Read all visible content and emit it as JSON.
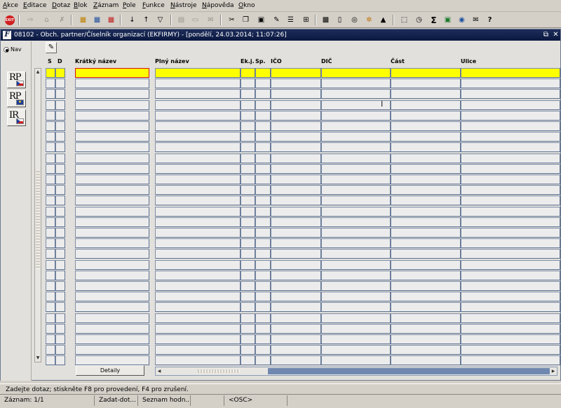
{
  "menu": [
    {
      "u": "A",
      "rest": "kce"
    },
    {
      "u": "E",
      "rest": "ditace"
    },
    {
      "u": "D",
      "rest": "otaz"
    },
    {
      "u": "B",
      "rest": "lok"
    },
    {
      "u": "Z",
      "rest": "áznam"
    },
    {
      "u": "P",
      "rest": "ole"
    },
    {
      "u": "F",
      "rest": "unkce"
    },
    {
      "u": "N",
      "rest": "ástroje"
    },
    {
      "u": "N",
      "rest": "ápověda"
    },
    {
      "u": "O",
      "rest": "kno"
    }
  ],
  "toolbar": {
    "exit_label": "EXIT",
    "sum_symbol": "Σ"
  },
  "window": {
    "icon_letter": "F",
    "title": "08102 - Obch. partner/Číselník organizací (EKFIRMY) - [pondělí, 24.03.2014; 11:07:26]",
    "restore_symbol": "⧉",
    "close_symbol": "✕"
  },
  "nav": {
    "label": "Nav",
    "buttons": [
      {
        "text": "RP",
        "flag": "cz"
      },
      {
        "text": "RP",
        "flag": "eu"
      },
      {
        "text": "IR",
        "flag": "cz"
      }
    ]
  },
  "grid": {
    "columns": [
      "S",
      "D",
      "Krátký název",
      "Plný název",
      "Ek.j.",
      "Sp.",
      "IČO",
      "DIČ",
      "Část",
      "Ulice"
    ],
    "row_count": 28,
    "current_row": 1
  },
  "detail_button": "Detaily",
  "status": {
    "message": "Zadejte dotaz; stiskněte F8 pro provedení, F4 pro zrušení.",
    "record": "Záznam: 1/1",
    "mode": "Zadat-dot...",
    "list": "Seznam hodn...",
    "osc": "<OSC>"
  }
}
